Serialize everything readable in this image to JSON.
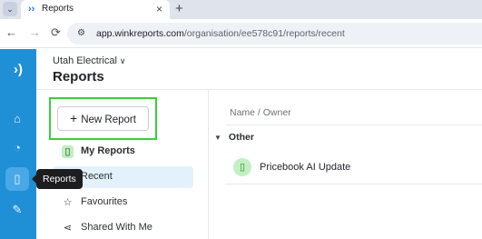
{
  "browser": {
    "tab_title": "Reports",
    "tab_close": "×",
    "new_tab": "+",
    "tab_menu": "⌄",
    "back": "←",
    "forward": "→",
    "reload": "⟳",
    "url_host": "app.winkreports.com",
    "url_path": "/organisation/ee578c91/reports/recent"
  },
  "rail": {
    "items": [
      {
        "icon": "home-icon",
        "glyph": "⌂"
      },
      {
        "icon": "gauge-icon",
        "glyph": "◔"
      },
      {
        "icon": "report-icon",
        "glyph": "▯"
      },
      {
        "icon": "plug-icon",
        "glyph": "✎"
      }
    ],
    "tooltip": "Reports"
  },
  "header": {
    "org_name": "Utah Electrical",
    "org_chevron": "∨",
    "title": "Reports"
  },
  "sidebar": {
    "new_report_label": "New Report",
    "items": [
      {
        "label": "My Reports",
        "icon": "report-icon"
      },
      {
        "label": "Recent",
        "icon": "clock-icon"
      },
      {
        "label": "Favourites",
        "icon": "star-icon"
      },
      {
        "label": "Shared With Me",
        "icon": "share-icon"
      }
    ]
  },
  "main": {
    "column_header": "Name / Owner",
    "group_label": "Other",
    "rows": [
      {
        "name": "Pricebook AI Update",
        "icon": "report-icon"
      }
    ]
  },
  "colors": {
    "rail": "#1f8fd6",
    "highlight": "#3dcc3d",
    "selected_bg": "#e3f1fc"
  }
}
